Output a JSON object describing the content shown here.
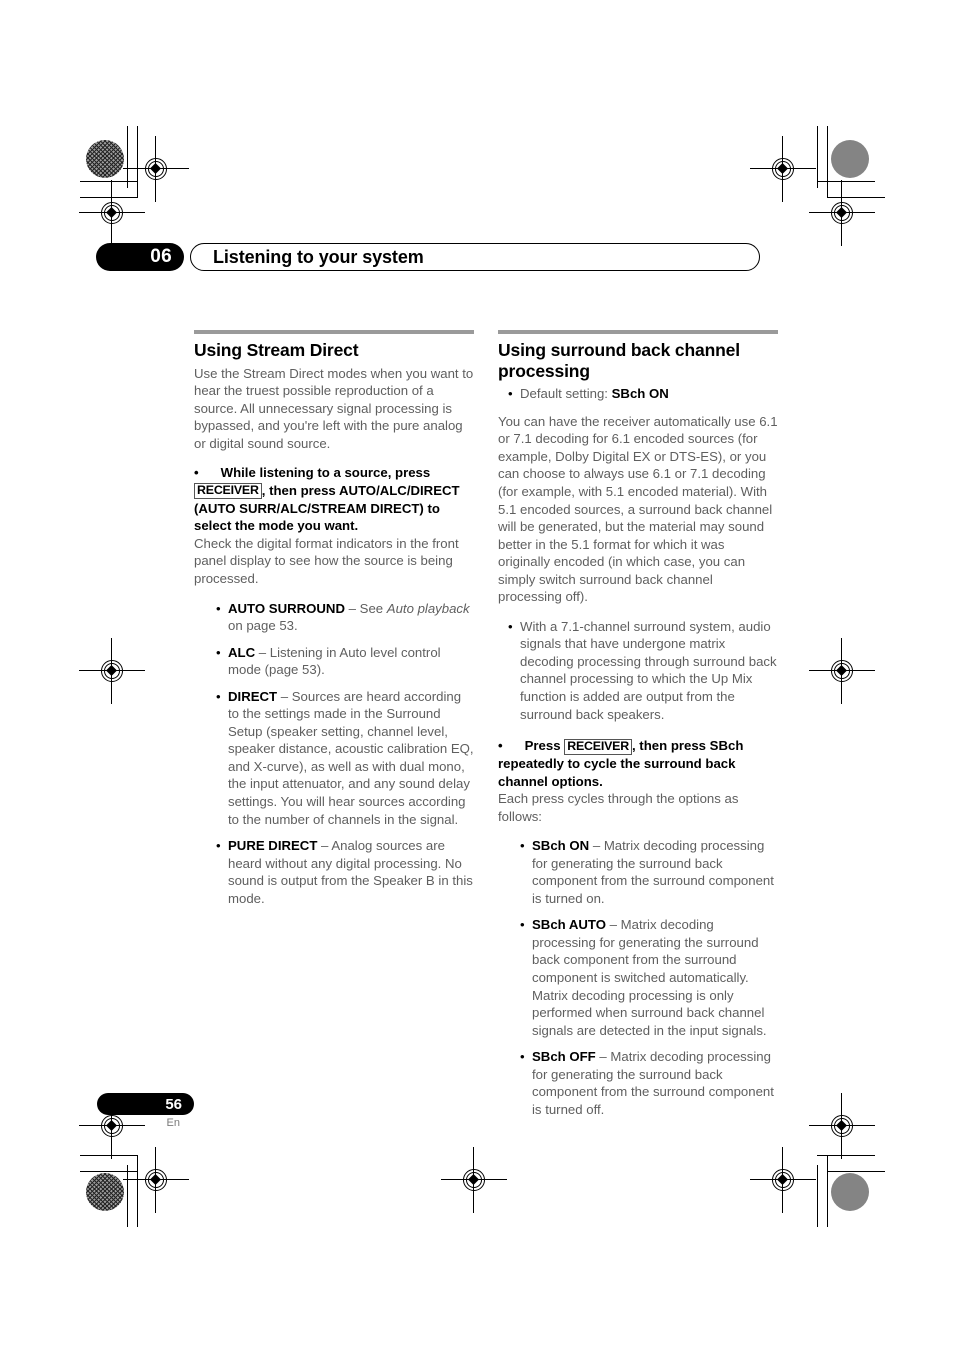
{
  "header": {
    "chapter_number": "06",
    "chapter_title": "Listening to your system"
  },
  "footer": {
    "page_number": "56",
    "language_code": "En"
  },
  "left_column": {
    "heading": "Using Stream Direct",
    "intro": "Use the Stream Direct modes when you want to hear the truest possible reproduction of a source. All unnecessary signal processing is bypassed, and you're left with the pure analog or digital sound source.",
    "instruction": {
      "bullet": "•",
      "before_key": "While listening to a source, press",
      "key_label": "RECEIVER",
      "after_key": ", then press AUTO/ALC/DIRECT (AUTO SURR/ALC/STREAM DIRECT) to select the mode you want."
    },
    "instruction_followup": "Check the digital format indicators in the front panel display to see how the source is being processed.",
    "modes": [
      {
        "term": "AUTO SURROUND",
        "text_before_italic": " – See ",
        "italic": "Auto playback",
        "text_after_italic": " on page 53."
      },
      {
        "term": "ALC",
        "text_before_italic": " – Listening in Auto level control mode (page 53).",
        "italic": "",
        "text_after_italic": ""
      },
      {
        "term": "DIRECT",
        "text_before_italic": " – Sources are heard according to the settings made in the Surround Setup (speaker setting, channel level, speaker distance, acoustic calibration EQ, and X-curve), as well as with dual mono, the input attenuator, and any sound delay settings. You will hear sources according to the number of channels in the signal.",
        "italic": "",
        "text_after_italic": ""
      },
      {
        "term": "PURE DIRECT",
        "text_before_italic": " – Analog sources are heard without any digital processing. No sound is output from the Speaker B in this mode.",
        "italic": "",
        "text_after_italic": ""
      }
    ]
  },
  "right_column": {
    "heading": "Using surround back channel processing",
    "default_setting": {
      "label": "Default setting: ",
      "value": "SBch ON"
    },
    "intro": "You can have the receiver automatically use 6.1 or 7.1 decoding for 6.1 encoded sources (for example, Dolby Digital EX or DTS-ES), or you can choose to always use 6.1 or 7.1 decoding (for example, with 5.1 encoded material). With 5.1 encoded sources, a surround back channel will be generated, but the material may sound better in the 5.1 format for which it was originally encoded (in which case, you can simply switch surround back channel processing off).",
    "note": "With a 7.1-channel surround system, audio signals that have undergone matrix decoding processing through surround back channel processing to which the Up Mix function is added are output from the surround back speakers.",
    "instruction": {
      "bullet": "•",
      "before_key": "Press ",
      "key_label": "RECEIVER",
      "after_key": ", then press SBch repeatedly to cycle the surround back channel options."
    },
    "instruction_followup": "Each press cycles through the options as follows:",
    "options": [
      {
        "term": "SBch ON",
        "text": " – Matrix decoding processing for generating the surround back component from the surround component is turned on."
      },
      {
        "term": "SBch AUTO",
        "text": " – Matrix decoding processing for generating the surround back component from the surround component is switched automatically. Matrix decoding processing is only performed when surround back channel signals are detected in the input signals."
      },
      {
        "term": "SBch OFF",
        "text": " – Matrix decoding processing for generating the surround back component from the surround component is turned off."
      }
    ]
  }
}
